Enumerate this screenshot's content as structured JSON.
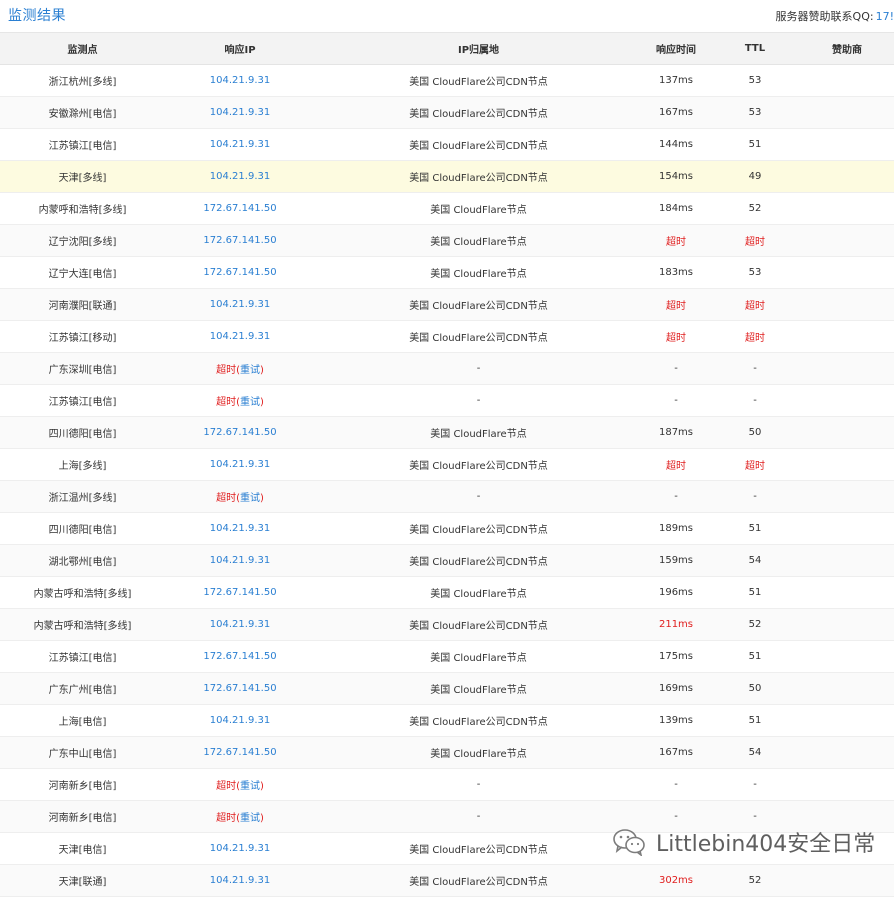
{
  "header": {
    "title": "监测结果",
    "sponsor_label": "服务器赞助联系QQ:",
    "sponsor_qq": "17!"
  },
  "columns": [
    "监测点",
    "响应IP",
    "IP归属地",
    "响应时间",
    "TTL",
    "赞助商"
  ],
  "rows": [
    {
      "location": "浙江杭州[多线]",
      "ip": "104.21.9.31",
      "region": "美国 CloudFlare公司CDN节点",
      "time": "137ms",
      "ttl": "53"
    },
    {
      "location": "安徽滁州[电信]",
      "ip": "104.21.9.31",
      "region": "美国 CloudFlare公司CDN节点",
      "time": "167ms",
      "ttl": "53"
    },
    {
      "location": "江苏镇江[电信]",
      "ip": "104.21.9.31",
      "region": "美国 CloudFlare公司CDN节点",
      "time": "144ms",
      "ttl": "51"
    },
    {
      "location": "天津[多线]",
      "ip": "104.21.9.31",
      "region": "美国 CloudFlare公司CDN节点",
      "time": "154ms",
      "ttl": "49",
      "highlight": true
    },
    {
      "location": "内蒙呼和浩特[多线]",
      "ip": "172.67.141.50",
      "region": "美国 CloudFlare节点",
      "time": "184ms",
      "ttl": "52"
    },
    {
      "location": "辽宁沈阳[多线]",
      "ip": "172.67.141.50",
      "region": "美国 CloudFlare节点",
      "time": "超时",
      "ttl": "超时"
    },
    {
      "location": "辽宁大连[电信]",
      "ip": "172.67.141.50",
      "region": "美国 CloudFlare节点",
      "time": "183ms",
      "ttl": "53"
    },
    {
      "location": "河南濮阳[联通]",
      "ip": "104.21.9.31",
      "region": "美国 CloudFlare公司CDN节点",
      "time": "超时",
      "ttl": "超时"
    },
    {
      "location": "江苏镇江[移动]",
      "ip": "104.21.9.31",
      "region": "美国 CloudFlare公司CDN节点",
      "time": "超时",
      "ttl": "超时"
    },
    {
      "location": "广东深圳[电信]",
      "ip": "超时",
      "retry": "重试",
      "region": "-",
      "time": "-",
      "ttl": "-"
    },
    {
      "location": "江苏镇江[电信]",
      "ip": "超时",
      "retry": "重试",
      "region": "-",
      "time": "-",
      "ttl": "-"
    },
    {
      "location": "四川德阳[电信]",
      "ip": "172.67.141.50",
      "region": "美国 CloudFlare节点",
      "time": "187ms",
      "ttl": "50"
    },
    {
      "location": "上海[多线]",
      "ip": "104.21.9.31",
      "region": "美国 CloudFlare公司CDN节点",
      "time": "超时",
      "ttl": "超时"
    },
    {
      "location": "浙江温州[多线]",
      "ip": "超时",
      "retry": "重试",
      "region": "-",
      "time": "-",
      "ttl": "-"
    },
    {
      "location": "四川德阳[电信]",
      "ip": "104.21.9.31",
      "region": "美国 CloudFlare公司CDN节点",
      "time": "189ms",
      "ttl": "51"
    },
    {
      "location": "湖北鄂州[电信]",
      "ip": "104.21.9.31",
      "region": "美国 CloudFlare公司CDN节点",
      "time": "159ms",
      "ttl": "54"
    },
    {
      "location": "内蒙古呼和浩特[多线]",
      "ip": "172.67.141.50",
      "region": "美国 CloudFlare节点",
      "time": "196ms",
      "ttl": "51"
    },
    {
      "location": "内蒙古呼和浩特[多线]",
      "ip": "104.21.9.31",
      "region": "美国 CloudFlare公司CDN节点",
      "time": "211ms",
      "ttl": "52",
      "slow": true
    },
    {
      "location": "江苏镇江[电信]",
      "ip": "172.67.141.50",
      "region": "美国 CloudFlare节点",
      "time": "175ms",
      "ttl": "51"
    },
    {
      "location": "广东广州[电信]",
      "ip": "172.67.141.50",
      "region": "美国 CloudFlare节点",
      "time": "169ms",
      "ttl": "50"
    },
    {
      "location": "上海[电信]",
      "ip": "104.21.9.31",
      "region": "美国 CloudFlare公司CDN节点",
      "time": "139ms",
      "ttl": "51"
    },
    {
      "location": "广东中山[电信]",
      "ip": "172.67.141.50",
      "region": "美国 CloudFlare节点",
      "time": "167ms",
      "ttl": "54"
    },
    {
      "location": "河南新乡[电信]",
      "ip": "超时",
      "retry": "重试",
      "region": "-",
      "time": "-",
      "ttl": "-"
    },
    {
      "location": "河南新乡[电信]",
      "ip": "超时",
      "retry": "重试",
      "region": "-",
      "time": "-",
      "ttl": "-"
    },
    {
      "location": "天津[电信]",
      "ip": "104.21.9.31",
      "region": "美国 CloudFlare公司CDN节点",
      "time": "",
      "ttl": ""
    },
    {
      "location": "天津[联通]",
      "ip": "104.21.9.31",
      "region": "美国 CloudFlare公司CDN节点",
      "time": "302ms",
      "ttl": "52",
      "slow": true
    }
  ],
  "watermark": {
    "text": "Littlebin404安全日常",
    "icon": "wechat-icon"
  },
  "colors": {
    "link": "#2a7fd2",
    "error": "#e02020",
    "highlight_row": "#fdfbe0",
    "header_bg": "#f3f3f3"
  }
}
